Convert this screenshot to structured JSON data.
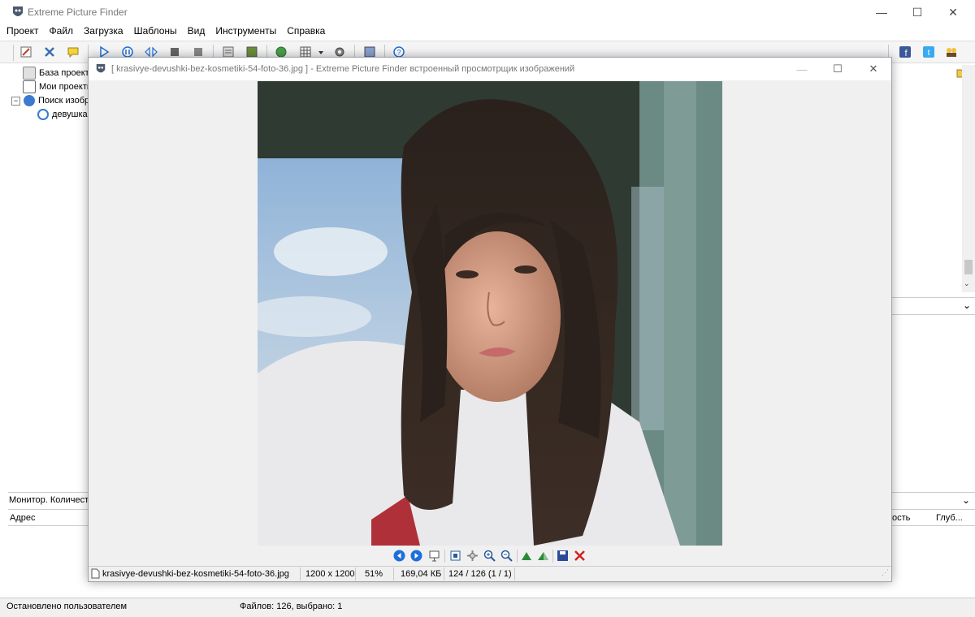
{
  "app": {
    "title": "Extreme Picture Finder",
    "menu": [
      "Проект",
      "Файл",
      "Загрузка",
      "Шаблоны",
      "Вид",
      "Инструменты",
      "Справка"
    ]
  },
  "tree": {
    "items": [
      {
        "label": "База проект",
        "icon": "database-icon"
      },
      {
        "label": "Мои проекты",
        "icon": "projects-icon"
      },
      {
        "label": "Поиск изобр",
        "icon": "globe-search-icon",
        "expander": "−"
      },
      {
        "label": "девушка",
        "icon": "magnifier-icon"
      }
    ]
  },
  "monitor": {
    "label": "Монитор. Количест",
    "columns": {
      "address": "Адрес",
      "speed": "ость",
      "depth": "Глуб..."
    }
  },
  "status": {
    "left": "Остановлено пользователем",
    "files": "Файлов: 126, выбрано: 1"
  },
  "viewer": {
    "title": "[ krasivye-devushki-bez-kosmetiki-54-foto-36.jpg ] - Extreme Picture Finder встроенный просмотрщик изображений",
    "filename": "krasivye-devushki-bez-kosmetiki-54-foto-36.jpg",
    "dimensions": "1200 x 1200",
    "zoom": "51%",
    "filesize": "169,04 КБ",
    "position": "124 / 126 (1 / 1)"
  },
  "colors": {
    "accent_blue": "#1e6fd9",
    "delete_red": "#d32020",
    "toolbar_bg": "#f5f5f5"
  }
}
